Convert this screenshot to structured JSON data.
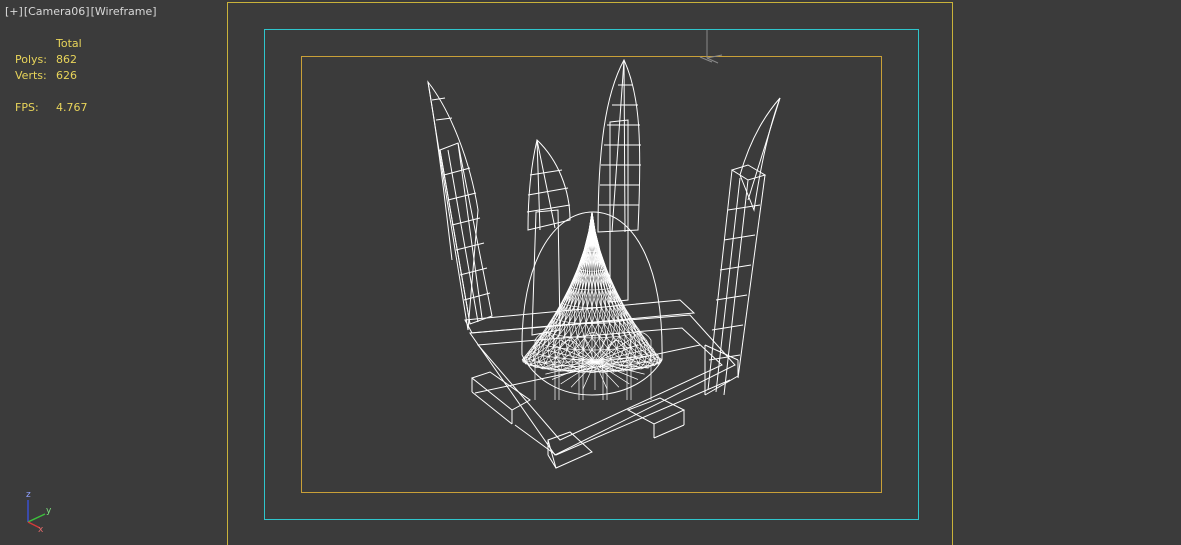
{
  "viewport": {
    "label_plus": "[+]",
    "label_camera": "[Camera06]",
    "label_shading": "[Wireframe]"
  },
  "stats": {
    "header": "Total",
    "polys_label": "Polys:",
    "polys_value": "862",
    "verts_label": "Verts:",
    "verts_value": "626",
    "fps_label": "FPS:",
    "fps_value": "4.767"
  },
  "gizmo": {
    "z": "z",
    "y": "y",
    "x": "x"
  },
  "colors": {
    "background": "#3b3b3b",
    "stats_text": "#e8d45a",
    "safe_frame": "#c9b23a",
    "action_safe": "#2fc5cc",
    "wireframe": "#ffffff"
  }
}
